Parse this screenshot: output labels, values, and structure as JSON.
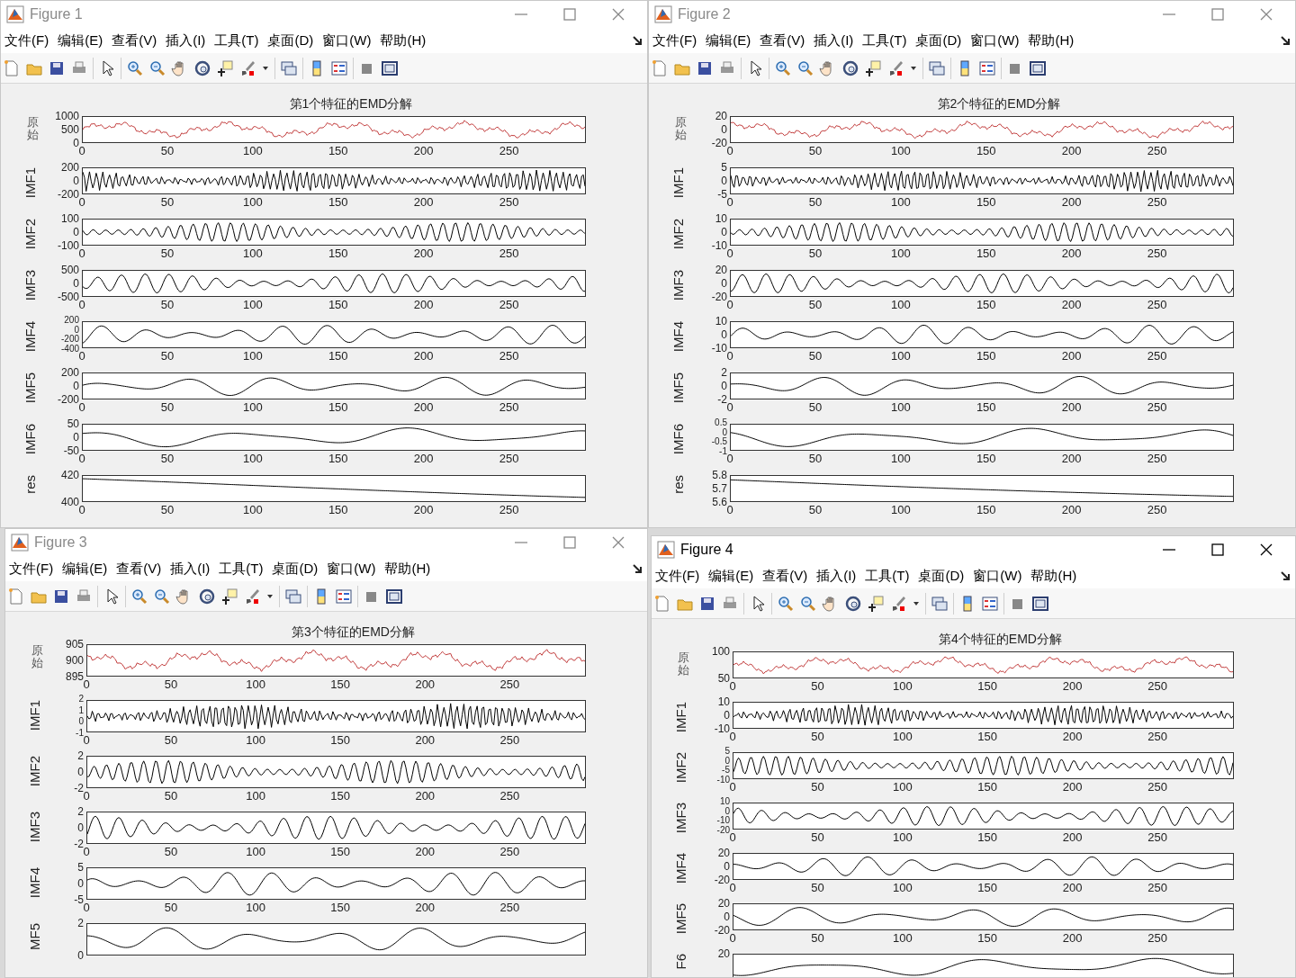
{
  "windows": [
    {
      "title": "Figure 1",
      "active": false,
      "menu": [
        "文件(F)",
        "编辑(E)",
        "查看(V)",
        "插入(I)",
        "工具(T)",
        "桌面(D)",
        "窗口(W)",
        "帮助(H)"
      ],
      "figure": {
        "title": "第1个特征的EMD分解",
        "subplots": [
          {
            "kind": "signal",
            "ylabel": "原始",
            "color": "#c23b3b",
            "yticks": [
              "1000",
              "500",
              "0"
            ],
            "xticks": [
              "0",
              "50",
              "100",
              "150",
              "200",
              "250"
            ]
          },
          {
            "kind": "imf",
            "ylabel": "IMF1",
            "color": "#000000",
            "yticks": [
              "200",
              "0",
              "-200"
            ],
            "xticks": [
              "0",
              "50",
              "100",
              "150",
              "200",
              "250"
            ]
          },
          {
            "kind": "imf",
            "ylabel": "IMF2",
            "color": "#000000",
            "yticks": [
              "100",
              "0",
              "-100"
            ],
            "xticks": [
              "0",
              "50",
              "100",
              "150",
              "200",
              "250"
            ]
          },
          {
            "kind": "imf",
            "ylabel": "IMF3",
            "color": "#000000",
            "yticks": [
              "500",
              "0",
              "-500"
            ],
            "xticks": [
              "0",
              "50",
              "100",
              "150",
              "200",
              "250"
            ]
          },
          {
            "kind": "imf",
            "ylabel": "IMF4",
            "color": "#000000",
            "yticks": [
              "200",
              "0",
              "-200",
              "-400"
            ],
            "xticks": [
              "0",
              "50",
              "100",
              "150",
              "200",
              "250"
            ]
          },
          {
            "kind": "imf",
            "ylabel": "IMF5",
            "color": "#000000",
            "yticks": [
              "200",
              "0",
              "-200"
            ],
            "xticks": [
              "0",
              "50",
              "100",
              "150",
              "200",
              "250"
            ]
          },
          {
            "kind": "imf",
            "ylabel": "IMF6",
            "color": "#000000",
            "yticks": [
              "50",
              "0",
              "-50"
            ],
            "xticks": [
              "0",
              "50",
              "100",
              "150",
              "200",
              "250"
            ]
          },
          {
            "kind": "residual",
            "ylabel": "res",
            "color": "#000000",
            "yticks": [
              "420",
              "400"
            ],
            "xticks": [
              "0",
              "50",
              "100",
              "150",
              "200",
              "250"
            ]
          }
        ]
      }
    },
    {
      "title": "Figure 2",
      "active": false,
      "menu": [
        "文件(F)",
        "编辑(E)",
        "查看(V)",
        "插入(I)",
        "工具(T)",
        "桌面(D)",
        "窗口(W)",
        "帮助(H)"
      ],
      "figure": {
        "title": "第2个特征的EMD分解",
        "subplots": [
          {
            "kind": "signal",
            "ylabel": "原始",
            "color": "#c23b3b",
            "yticks": [
              "20",
              "0",
              "-20"
            ],
            "xticks": [
              "0",
              "50",
              "100",
              "150",
              "200",
              "250"
            ]
          },
          {
            "kind": "imf",
            "ylabel": "IMF1",
            "color": "#000000",
            "yticks": [
              "5",
              "0",
              "-5"
            ],
            "xticks": [
              "0",
              "50",
              "100",
              "150",
              "200",
              "250"
            ]
          },
          {
            "kind": "imf",
            "ylabel": "IMF2",
            "color": "#000000",
            "yticks": [
              "10",
              "0",
              "-10"
            ],
            "xticks": [
              "0",
              "50",
              "100",
              "150",
              "200",
              "250"
            ]
          },
          {
            "kind": "imf",
            "ylabel": "IMF3",
            "color": "#000000",
            "yticks": [
              "20",
              "0",
              "-20"
            ],
            "xticks": [
              "0",
              "50",
              "100",
              "150",
              "200",
              "250"
            ]
          },
          {
            "kind": "imf",
            "ylabel": "IMF4",
            "color": "#000000",
            "yticks": [
              "10",
              "0",
              "-10"
            ],
            "xticks": [
              "0",
              "50",
              "100",
              "150",
              "200",
              "250"
            ]
          },
          {
            "kind": "imf",
            "ylabel": "IMF5",
            "color": "#000000",
            "yticks": [
              "2",
              "0",
              "-2"
            ],
            "xticks": [
              "0",
              "50",
              "100",
              "150",
              "200",
              "250"
            ]
          },
          {
            "kind": "imf",
            "ylabel": "IMF6",
            "color": "#000000",
            "yticks": [
              "0.5",
              "0",
              "-0.5",
              "-1"
            ],
            "xticks": [
              "0",
              "50",
              "100",
              "150",
              "200",
              "250"
            ]
          },
          {
            "kind": "residual",
            "ylabel": "res",
            "color": "#000000",
            "yticks": [
              "5.8",
              "5.7",
              "5.6"
            ],
            "xticks": [
              "0",
              "50",
              "100",
              "150",
              "200",
              "250"
            ]
          }
        ]
      }
    },
    {
      "title": "Figure 3",
      "active": false,
      "menu": [
        "文件(F)",
        "编辑(E)",
        "查看(V)",
        "插入(I)",
        "工具(T)",
        "桌面(D)",
        "窗口(W)",
        "帮助(H)"
      ],
      "figure": {
        "title": "第3个特征的EMD分解",
        "subplots": [
          {
            "kind": "signal",
            "ylabel": "原始",
            "color": "#c23b3b",
            "yticks": [
              "905",
              "900",
              "895"
            ],
            "xticks": [
              "0",
              "50",
              "100",
              "150",
              "200",
              "250"
            ]
          },
          {
            "kind": "imf",
            "ylabel": "IMF1",
            "color": "#000000",
            "yticks": [
              "2",
              "1",
              "0",
              "-1"
            ],
            "xticks": [
              "0",
              "50",
              "100",
              "150",
              "200",
              "250"
            ]
          },
          {
            "kind": "imf",
            "ylabel": "IMF2",
            "color": "#000000",
            "yticks": [
              "2",
              "0",
              "-2"
            ],
            "xticks": [
              "0",
              "50",
              "100",
              "150",
              "200",
              "250"
            ]
          },
          {
            "kind": "imf",
            "ylabel": "IMF3",
            "color": "#000000",
            "yticks": [
              "2",
              "0",
              "-2"
            ],
            "xticks": [
              "0",
              "50",
              "100",
              "150",
              "200",
              "250"
            ]
          },
          {
            "kind": "imf",
            "ylabel": "IMF4",
            "color": "#000000",
            "yticks": [
              "5",
              "0",
              "-5"
            ],
            "xticks": [
              "0",
              "50",
              "100",
              "150",
              "200",
              "250"
            ]
          },
          {
            "kind": "imf",
            "ylabel": "MF5",
            "color": "#000000",
            "yticks": [
              "2",
              "0"
            ]
          }
        ]
      }
    },
    {
      "title": "Figure 4",
      "active": true,
      "menu": [
        "文件(F)",
        "编辑(E)",
        "查看(V)",
        "插入(I)",
        "工具(T)",
        "桌面(D)",
        "窗口(W)",
        "帮助(H)"
      ],
      "figure": {
        "title": "第4个特征的EMD分解",
        "subplots": [
          {
            "kind": "signal",
            "ylabel": "原始",
            "color": "#c23b3b",
            "yticks": [
              "100",
              "50"
            ],
            "xticks": [
              "0",
              "50",
              "100",
              "150",
              "200",
              "250"
            ]
          },
          {
            "kind": "imf",
            "ylabel": "IMF1",
            "color": "#000000",
            "yticks": [
              "10",
              "0",
              "-10"
            ],
            "xticks": [
              "0",
              "50",
              "100",
              "150",
              "200",
              "250"
            ]
          },
          {
            "kind": "imf",
            "ylabel": "IMF2",
            "color": "#000000",
            "yticks": [
              "5",
              "0",
              "-5",
              "-10"
            ],
            "xticks": [
              "0",
              "50",
              "100",
              "150",
              "200",
              "250"
            ]
          },
          {
            "kind": "imf",
            "ylabel": "IMF3",
            "color": "#000000",
            "yticks": [
              "10",
              "0",
              "-10",
              "-20"
            ],
            "xticks": [
              "0",
              "50",
              "100",
              "150",
              "200",
              "250"
            ]
          },
          {
            "kind": "imf",
            "ylabel": "IMF4",
            "color": "#000000",
            "yticks": [
              "20",
              "0",
              "-20"
            ],
            "xticks": [
              "0",
              "50",
              "100",
              "150",
              "200",
              "250"
            ]
          },
          {
            "kind": "imf",
            "ylabel": "IMF5",
            "color": "#000000",
            "yticks": [
              "20",
              "0",
              "-20"
            ],
            "xticks": [
              "0",
              "50",
              "100",
              "150",
              "200",
              "250"
            ]
          },
          {
            "kind": "imf",
            "ylabel": "F6",
            "color": "#000000",
            "yticks": [
              "20"
            ]
          }
        ]
      }
    }
  ]
}
